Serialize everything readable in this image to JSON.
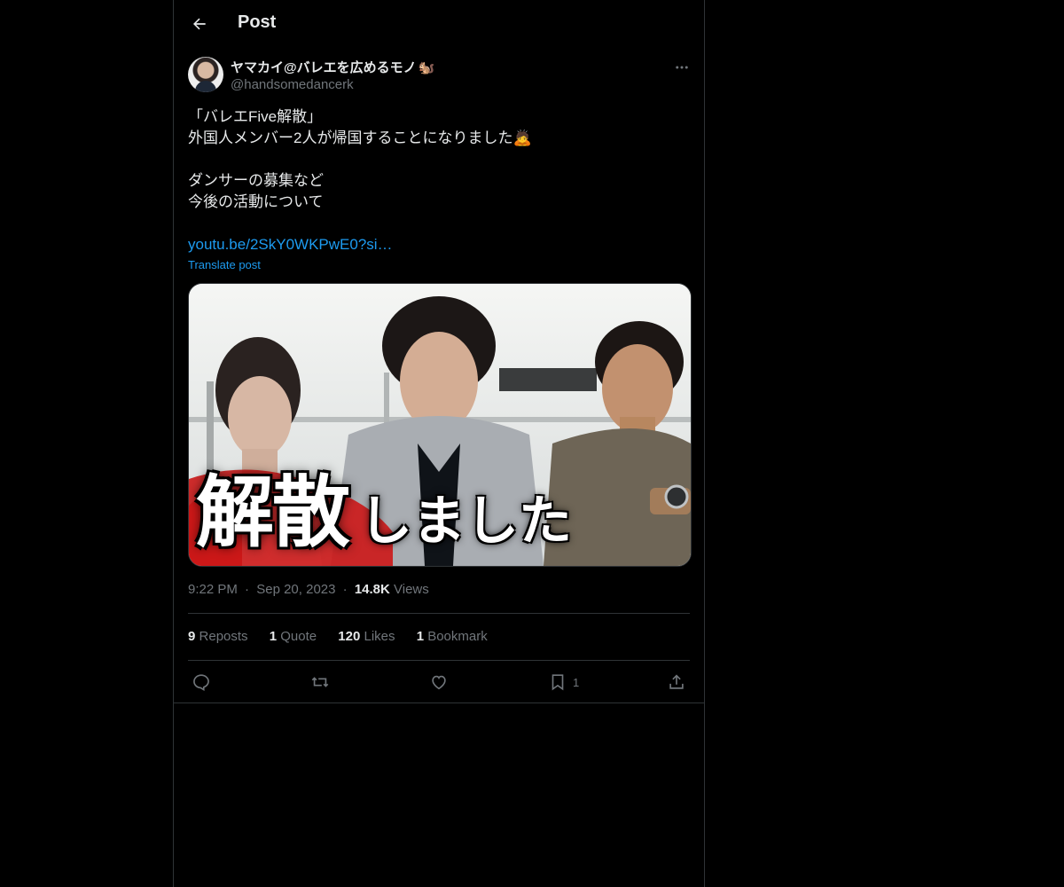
{
  "header": {
    "title": "Post"
  },
  "author": {
    "display_name": "ヤマカイ@バレエを広めるモノ",
    "name_emoji": "🐿️",
    "handle": "@handsomedancerk"
  },
  "post": {
    "text": "「バレエFive解散」\n外国人メンバー2人が帰国することになりました",
    "text_emoji": "🙇",
    "text_2": "\n\nダンサーの募集など\n今後の活動について\n\n",
    "link": "youtu.be/2SkY0WKPwE0?si…",
    "translate_label": "Translate post",
    "media_overlay_big": "解散",
    "media_overlay_small": "しました"
  },
  "meta": {
    "time": "9:22 PM",
    "separator": "·",
    "date": "Sep 20, 2023",
    "views_count": "14.8K",
    "views_label": "Views"
  },
  "stats": {
    "reposts_count": "9",
    "reposts_label": "Reposts",
    "quotes_count": "1",
    "quotes_label": "Quote",
    "likes_count": "120",
    "likes_label": "Likes",
    "bookmarks_count": "1",
    "bookmarks_label": "Bookmark"
  },
  "actions": {
    "bookmark_count": "1",
    "icons": [
      "reply-icon",
      "repost-icon",
      "like-icon",
      "bookmark-icon",
      "share-icon"
    ]
  },
  "colors": {
    "background": "#000000",
    "text": "#e7e9ea",
    "muted": "#71767b",
    "accent": "#1d9bf0",
    "border": "#2f3336"
  }
}
